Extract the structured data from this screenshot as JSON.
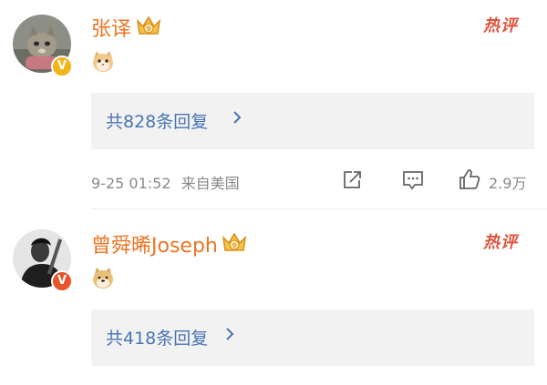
{
  "colors": {
    "username": "#ec7522",
    "hot_label": "#e0533e",
    "reply_link": "#4a74b5",
    "meta_text": "#8a8a8a",
    "reply_bg": "#f2f2f2"
  },
  "comments": [
    {
      "username": "张译",
      "badge": "crown-badge-icon",
      "verified": "V",
      "hot_label": "热评",
      "content_emoji": "cat-emoji-icon",
      "replies_label": "共828条回复",
      "timestamp": "9-25 01:52",
      "location": "来自美国",
      "likes": "2.9万"
    },
    {
      "username": "曾舜晞Joseph",
      "badge": "crown-badge-icon",
      "verified": "V",
      "hot_label": "热评",
      "content_emoji": "doge-emoji-icon",
      "replies_label": "共418条回复"
    }
  ]
}
